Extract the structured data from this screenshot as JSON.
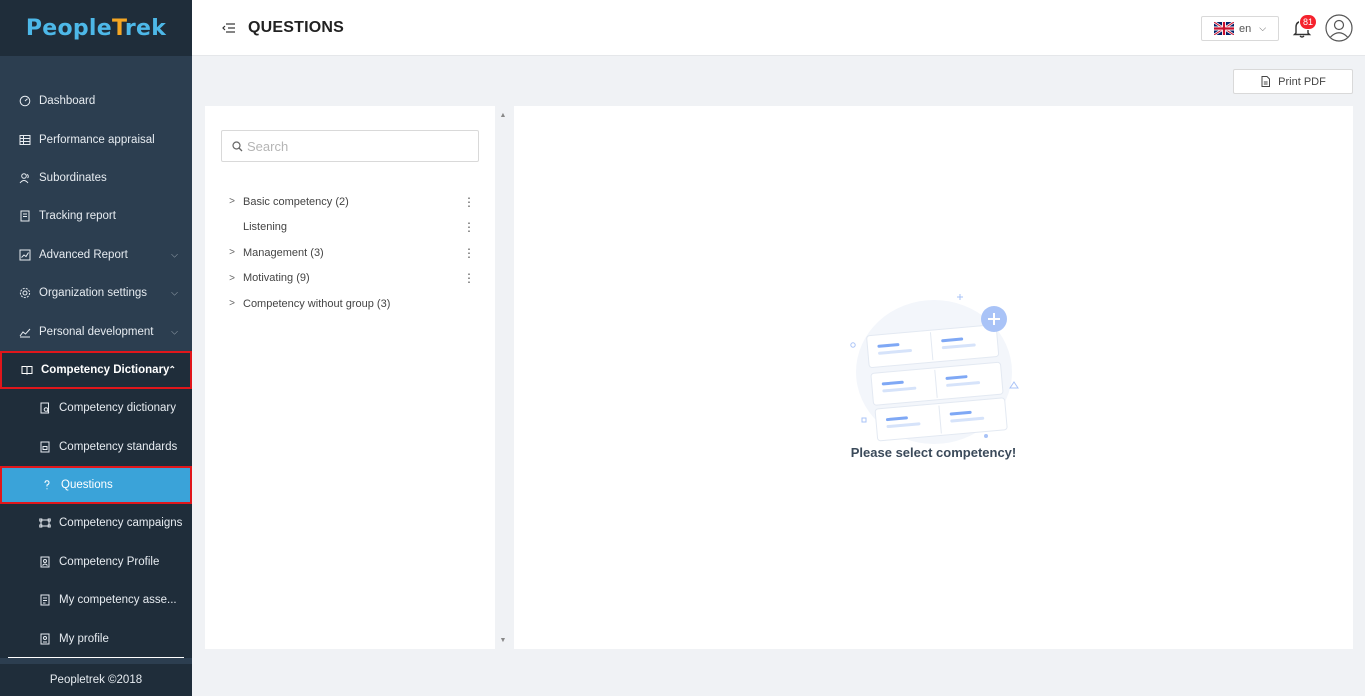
{
  "app": {
    "logo_text_a": "People",
    "logo_text_t": "T",
    "logo_text_b": "rek"
  },
  "header": {
    "title": "QUESTIONS",
    "language": "en",
    "notification_count": "81"
  },
  "sidebar": {
    "items": [
      {
        "label": "Dashboard",
        "icon": "dashboard-icon"
      },
      {
        "label": "Performance appraisal",
        "icon": "table-icon"
      },
      {
        "label": "Subordinates",
        "icon": "users-icon"
      },
      {
        "label": "Tracking report",
        "icon": "report-icon"
      },
      {
        "label": "Advanced Report",
        "icon": "chart-icon"
      },
      {
        "label": "Organization settings",
        "icon": "gear-icon"
      },
      {
        "label": "Personal development",
        "icon": "trend-icon"
      },
      {
        "label": "Competency Dictionary",
        "icon": "book-icon"
      }
    ],
    "subitems": [
      {
        "label": "Competency dictionary",
        "icon": "doc-search-icon"
      },
      {
        "label": "Competency standards",
        "icon": "doc-icon"
      },
      {
        "label": "Questions",
        "icon": "question-icon"
      },
      {
        "label": "Competency campaigns",
        "icon": "campaign-icon"
      },
      {
        "label": "Competency Profile",
        "icon": "profile-doc-icon"
      },
      {
        "label": "My competency asse...",
        "icon": "assessment-icon"
      },
      {
        "label": "My profile",
        "icon": "profile-icon"
      }
    ],
    "footer": "Peopletrek ©2018"
  },
  "toolbar": {
    "print_label": "Print PDF"
  },
  "search": {
    "placeholder": "Search"
  },
  "tree": [
    {
      "label": "Basic competency",
      "count": "(2)",
      "has_arrow": true,
      "has_menu": true
    },
    {
      "label": "Listening",
      "count": "",
      "has_arrow": false,
      "has_menu": true
    },
    {
      "label": "Management",
      "count": "(3)",
      "has_arrow": true,
      "has_menu": true
    },
    {
      "label": "Motivating",
      "count": "(9)",
      "has_arrow": true,
      "has_menu": true
    },
    {
      "label": "Competency without group",
      "count": "(3)",
      "has_arrow": true,
      "has_menu": false
    }
  ],
  "main": {
    "empty_message": "Please select competency!"
  },
  "colors": {
    "sidebar_bg": "#2c3e50",
    "active_bg": "#3aa3d9",
    "highlight_border": "#e0161b",
    "logo_blue": "#4db8e8",
    "logo_orange": "#f5a623"
  }
}
